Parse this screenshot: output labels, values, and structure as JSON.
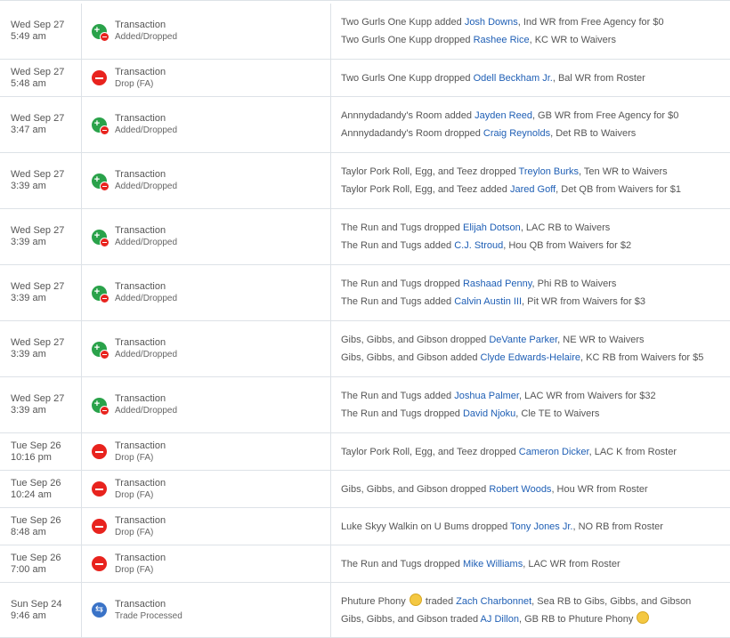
{
  "transactions": [
    {
      "date": "Wed Sep 27",
      "time": "5:49 am",
      "icon": "add",
      "type": "Transaction",
      "subtype": "Added/Dropped",
      "lines": [
        {
          "pre": "Two Gurls One Kupp added ",
          "player": "Josh Downs",
          "post": ", Ind WR from Free Agency for $0"
        },
        {
          "pre": "Two Gurls One Kupp dropped ",
          "player": "Rashee Rice",
          "post": ", KC WR to Waivers"
        }
      ]
    },
    {
      "date": "Wed Sep 27",
      "time": "5:48 am",
      "icon": "drop",
      "type": "Transaction",
      "subtype": "Drop (FA)",
      "lines": [
        {
          "pre": "Two Gurls One Kupp dropped ",
          "player": "Odell Beckham Jr.",
          "post": ", Bal WR from Roster"
        }
      ]
    },
    {
      "date": "Wed Sep 27",
      "time": "3:47 am",
      "icon": "add",
      "type": "Transaction",
      "subtype": "Added/Dropped",
      "lines": [
        {
          "pre": "Annnydadandy's Room added ",
          "player": "Jayden Reed",
          "post": ", GB WR from Free Agency for $0"
        },
        {
          "pre": "Annnydadandy's Room dropped ",
          "player": "Craig Reynolds",
          "post": ", Det RB to Waivers"
        }
      ]
    },
    {
      "date": "Wed Sep 27",
      "time": "3:39 am",
      "icon": "add",
      "type": "Transaction",
      "subtype": "Added/Dropped",
      "lines": [
        {
          "pre": "Taylor Pork Roll, Egg, and Teez dropped ",
          "player": "Treylon Burks",
          "post": ", Ten WR to Waivers"
        },
        {
          "pre": "Taylor Pork Roll, Egg, and Teez added ",
          "player": "Jared Goff",
          "post": ", Det QB from Waivers for $1"
        }
      ]
    },
    {
      "date": "Wed Sep 27",
      "time": "3:39 am",
      "icon": "add",
      "type": "Transaction",
      "subtype": "Added/Dropped",
      "lines": [
        {
          "pre": "The Run and Tugs dropped ",
          "player": "Elijah Dotson",
          "post": ", LAC RB to Waivers"
        },
        {
          "pre": "The Run and Tugs added ",
          "player": "C.J. Stroud",
          "post": ", Hou QB from Waivers for $2"
        }
      ]
    },
    {
      "date": "Wed Sep 27",
      "time": "3:39 am",
      "icon": "add",
      "type": "Transaction",
      "subtype": "Added/Dropped",
      "lines": [
        {
          "pre": "The Run and Tugs dropped ",
          "player": "Rashaad Penny",
          "post": ", Phi RB to Waivers"
        },
        {
          "pre": "The Run and Tugs added ",
          "player": "Calvin Austin III",
          "post": ", Pit WR from Waivers for $3"
        }
      ]
    },
    {
      "date": "Wed Sep 27",
      "time": "3:39 am",
      "icon": "add",
      "type": "Transaction",
      "subtype": "Added/Dropped",
      "lines": [
        {
          "pre": "Gibs, Gibbs, and Gibson dropped ",
          "player": "DeVante Parker",
          "post": ", NE WR to Waivers"
        },
        {
          "pre": "Gibs, Gibbs, and Gibson added ",
          "player": "Clyde Edwards-Helaire",
          "post": ", KC RB from Waivers for $5"
        }
      ]
    },
    {
      "date": "Wed Sep 27",
      "time": "3:39 am",
      "icon": "add",
      "type": "Transaction",
      "subtype": "Added/Dropped",
      "lines": [
        {
          "pre": "The Run and Tugs added ",
          "player": "Joshua Palmer",
          "post": ", LAC WR from Waivers for $32"
        },
        {
          "pre": "The Run and Tugs dropped ",
          "player": "David Njoku",
          "post": ", Cle TE to Waivers"
        }
      ]
    },
    {
      "date": "Tue Sep 26",
      "time": "10:16 pm",
      "icon": "drop",
      "type": "Transaction",
      "subtype": "Drop (FA)",
      "lines": [
        {
          "pre": "Taylor Pork Roll, Egg, and Teez dropped ",
          "player": "Cameron Dicker",
          "post": ", LAC K from Roster"
        }
      ]
    },
    {
      "date": "Tue Sep 26",
      "time": "10:24 am",
      "icon": "drop",
      "type": "Transaction",
      "subtype": "Drop (FA)",
      "lines": [
        {
          "pre": "Gibs, Gibbs, and Gibson dropped ",
          "player": "Robert Woods",
          "post": ", Hou WR from Roster"
        }
      ]
    },
    {
      "date": "Tue Sep 26",
      "time": "8:48 am",
      "icon": "drop",
      "type": "Transaction",
      "subtype": "Drop (FA)",
      "lines": [
        {
          "pre": "Luke Skyy Walkin on U Bums dropped ",
          "player": "Tony Jones Jr.",
          "post": ", NO RB from Roster"
        }
      ]
    },
    {
      "date": "Tue Sep 26",
      "time": "7:00 am",
      "icon": "drop",
      "type": "Transaction",
      "subtype": "Drop (FA)",
      "lines": [
        {
          "pre": "The Run and Tugs dropped ",
          "player": "Mike Williams",
          "post": ", LAC WR from Roster"
        }
      ]
    },
    {
      "date": "Sun Sep 24",
      "time": "9:46 am",
      "icon": "trade",
      "type": "Transaction",
      "subtype": "Trade Processed",
      "lines": [
        {
          "pre": "Phuture Phony ",
          "emoji": true,
          "mid": " traded ",
          "player": "Zach Charbonnet",
          "post": ", Sea RB to Gibs, Gibbs, and Gibson"
        },
        {
          "pre": "Gibs, Gibbs, and Gibson traded ",
          "player": "AJ Dillon",
          "post": ", GB RB to Phuture Phony ",
          "emojiEnd": true
        }
      ]
    }
  ]
}
